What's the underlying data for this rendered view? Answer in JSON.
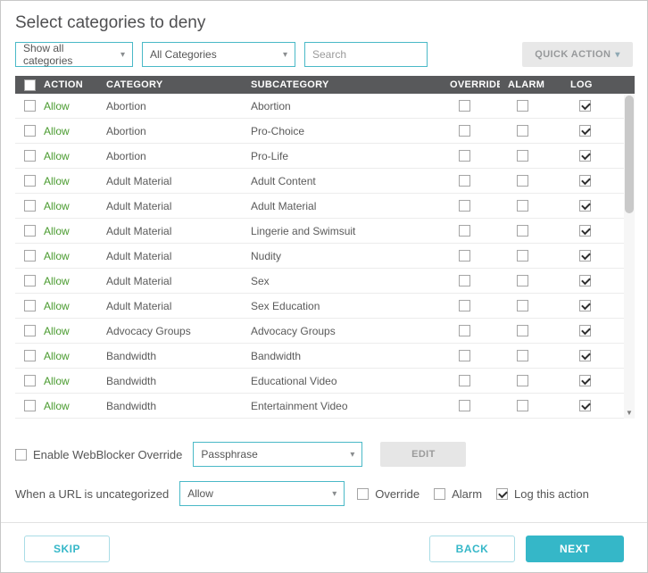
{
  "title": "Select categories to deny",
  "toolbar": {
    "filter_dropdown": "Show all categories",
    "category_dropdown": "All Categories",
    "search_placeholder": "Search",
    "quick_action_label": "QUICK ACTION"
  },
  "table": {
    "headers": [
      "ACTION",
      "CATEGORY",
      "SUBCATEGORY",
      "OVERRIDE",
      "ALARM",
      "LOG"
    ],
    "rows": [
      {
        "action": "Allow",
        "category": "Abortion",
        "subcategory": "Abortion",
        "override": false,
        "alarm": false,
        "log": true
      },
      {
        "action": "Allow",
        "category": "Abortion",
        "subcategory": "Pro-Choice",
        "override": false,
        "alarm": false,
        "log": true
      },
      {
        "action": "Allow",
        "category": "Abortion",
        "subcategory": "Pro-Life",
        "override": false,
        "alarm": false,
        "log": true
      },
      {
        "action": "Allow",
        "category": "Adult Material",
        "subcategory": "Adult Content",
        "override": false,
        "alarm": false,
        "log": true
      },
      {
        "action": "Allow",
        "category": "Adult Material",
        "subcategory": "Adult Material",
        "override": false,
        "alarm": false,
        "log": true
      },
      {
        "action": "Allow",
        "category": "Adult Material",
        "subcategory": "Lingerie and Swimsuit",
        "override": false,
        "alarm": false,
        "log": true
      },
      {
        "action": "Allow",
        "category": "Adult Material",
        "subcategory": "Nudity",
        "override": false,
        "alarm": false,
        "log": true
      },
      {
        "action": "Allow",
        "category": "Adult Material",
        "subcategory": "Sex",
        "override": false,
        "alarm": false,
        "log": true
      },
      {
        "action": "Allow",
        "category": "Adult Material",
        "subcategory": "Sex Education",
        "override": false,
        "alarm": false,
        "log": true
      },
      {
        "action": "Allow",
        "category": "Advocacy Groups",
        "subcategory": "Advocacy Groups",
        "override": false,
        "alarm": false,
        "log": true
      },
      {
        "action": "Allow",
        "category": "Bandwidth",
        "subcategory": "Bandwidth",
        "override": false,
        "alarm": false,
        "log": true
      },
      {
        "action": "Allow",
        "category": "Bandwidth",
        "subcategory": "Educational Video",
        "override": false,
        "alarm": false,
        "log": true
      },
      {
        "action": "Allow",
        "category": "Bandwidth",
        "subcategory": "Entertainment Video",
        "override": false,
        "alarm": false,
        "log": true
      }
    ]
  },
  "footer": {
    "enable_override_label": "Enable WebBlocker Override",
    "enable_override_checked": false,
    "passphrase_dropdown": "Passphrase",
    "edit_button": "EDIT",
    "uncategorized_label": "When a URL is uncategorized",
    "uncategorized_dropdown": "Allow",
    "override_label": "Override",
    "override_checked": false,
    "alarm_label": "Alarm",
    "alarm_checked": false,
    "log_label": "Log this action",
    "log_checked": true
  },
  "buttons": {
    "skip": "SKIP",
    "back": "BACK",
    "next": "NEXT"
  },
  "colors": {
    "accent": "#35b7c8",
    "table_header_bg": "#58595b",
    "allow_green": "#4a9b2f"
  }
}
